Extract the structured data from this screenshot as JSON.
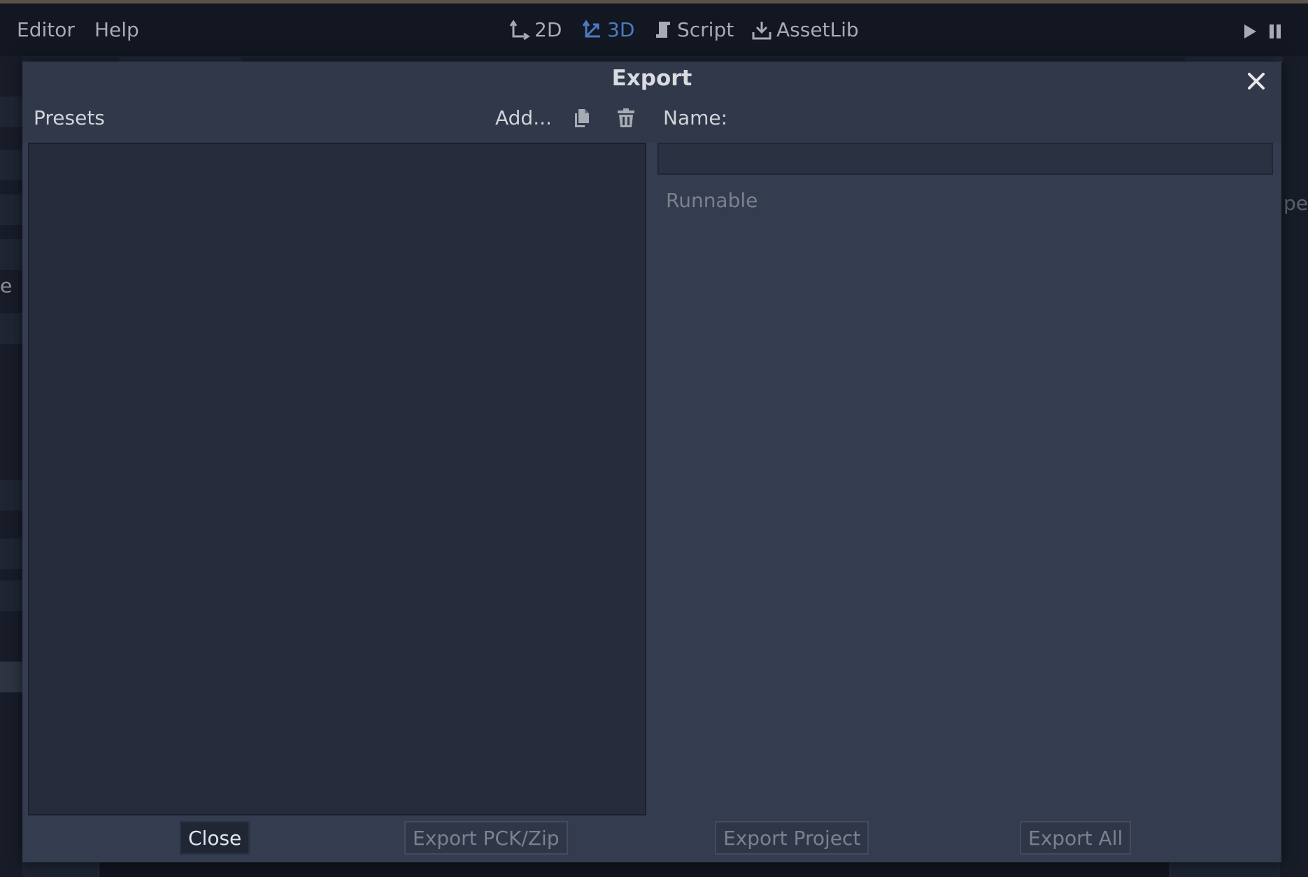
{
  "menubar": {
    "menus": [
      "Editor",
      "Help"
    ],
    "workspaces": [
      {
        "label": "2D",
        "icon": "2d-icon",
        "active": false
      },
      {
        "label": "3D",
        "icon": "3d-icon",
        "active": true
      },
      {
        "label": "Script",
        "icon": "script-icon",
        "active": false
      },
      {
        "label": "AssetLib",
        "icon": "download-icon",
        "active": false
      }
    ],
    "playback": {
      "play_icon": "play-icon",
      "pause_icon": "pause-icon"
    }
  },
  "background": {
    "left_glyph": "e",
    "right_glyph": "pe"
  },
  "dialog": {
    "title": "Export",
    "close_icon": "close-icon",
    "presets_label": "Presets",
    "add_label": "Add...",
    "duplicate_icon": "duplicate-icon",
    "delete_icon": "trash-icon",
    "name_label": "Name:",
    "name_value": "",
    "runnable_label": "Runnable",
    "buttons": {
      "close": "Close",
      "export_pck": "Export PCK/Zip",
      "export_project": "Export Project",
      "export_all": "Export All"
    }
  },
  "colors": {
    "accent": "#4d7ac2",
    "dialog_bg": "#343c4f",
    "list_bg": "#262c3b"
  }
}
